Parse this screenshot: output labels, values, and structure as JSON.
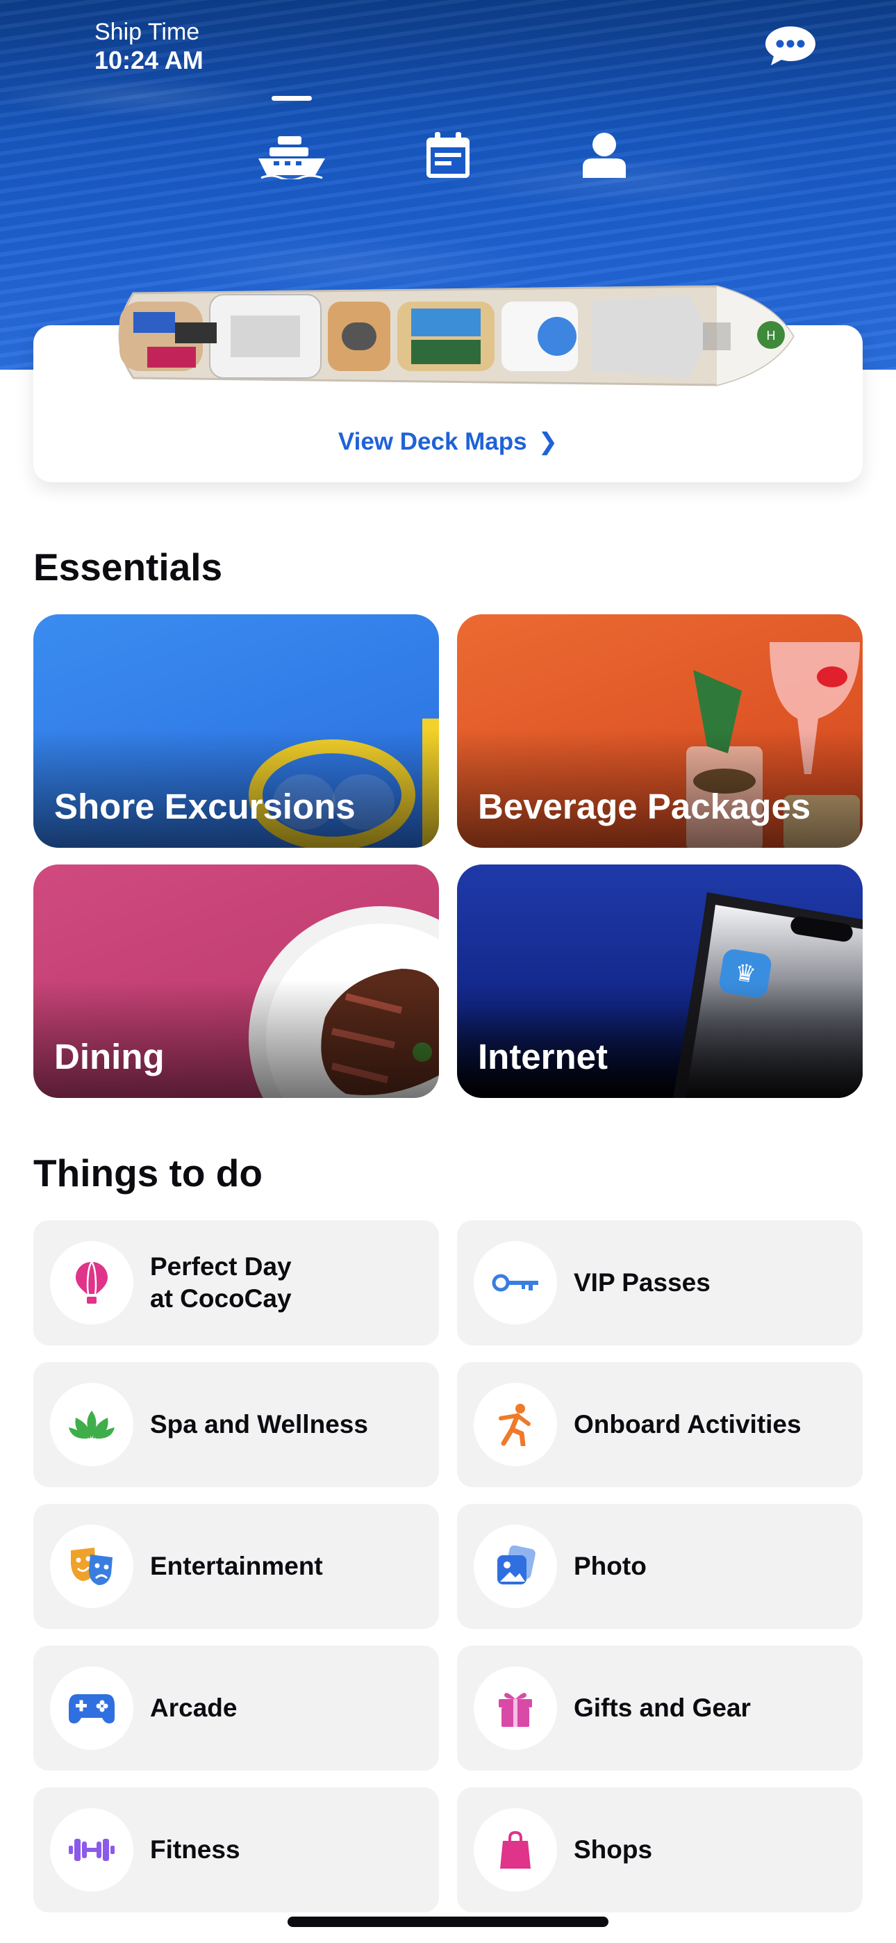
{
  "header": {
    "ship_time_label": "Ship Time",
    "ship_time_value": "10:24 AM",
    "chat_icon": "chat-bubble-icon",
    "tabs": [
      {
        "name": "ship",
        "icon": "ship-icon",
        "active": true
      },
      {
        "name": "calendar",
        "icon": "calendar-icon",
        "active": false
      },
      {
        "name": "profile",
        "icon": "person-icon",
        "active": false
      }
    ]
  },
  "deck": {
    "link_label": "View Deck Maps"
  },
  "essentials": {
    "title": "Essentials",
    "cards": [
      {
        "label": "Shore Excursions",
        "color": "#2f7fe8"
      },
      {
        "label": "Beverage Packages",
        "color": "#e8562a"
      },
      {
        "label": "Dining",
        "color": "#c8467a"
      },
      {
        "label": "Internet",
        "color": "#1e3aa8"
      }
    ]
  },
  "things_to_do": {
    "title": "Things to do",
    "items": [
      {
        "label": "Perfect Day at CocoCay",
        "icon": "hot-air-balloon-icon",
        "color": "#e0338a"
      },
      {
        "label": "VIP Passes",
        "icon": "key-icon",
        "color": "#3a7de0"
      },
      {
        "label": "Spa and Wellness",
        "icon": "lotus-icon",
        "color": "#3fae4a"
      },
      {
        "label": "Onboard Activities",
        "icon": "running-person-icon",
        "color": "#ee7a2a"
      },
      {
        "label": "Entertainment",
        "icon": "theater-masks-icon",
        "color": "#f0a12a"
      },
      {
        "label": "Photo",
        "icon": "photo-icon",
        "color": "#2f6fe0"
      },
      {
        "label": "Arcade",
        "icon": "game-controller-icon",
        "color": "#2f6fe0"
      },
      {
        "label": "Gifts and Gear",
        "icon": "gift-icon",
        "color": "#d94aa8"
      },
      {
        "label": "Fitness",
        "icon": "dumbbell-icon",
        "color": "#8a5be8"
      },
      {
        "label": "Shops",
        "icon": "shopping-bag-icon",
        "color": "#e0338a"
      }
    ]
  }
}
